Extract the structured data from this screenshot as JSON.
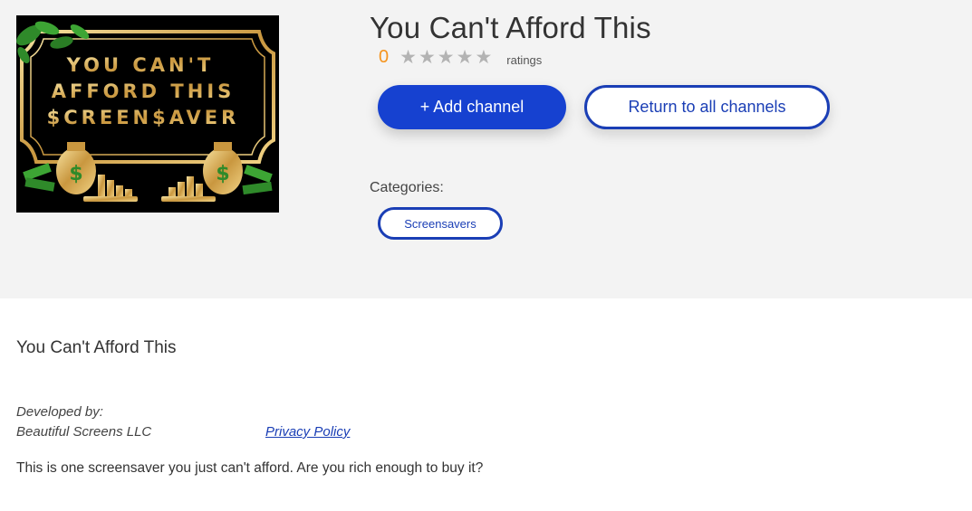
{
  "channel": {
    "title": "You Can't Afford This",
    "rating_count": "0",
    "stars": 5,
    "ratings_label": "ratings"
  },
  "poster": {
    "line1": "YOU CAN'T",
    "line2": "AFFORD THIS",
    "line3": "$CREEN$AVER",
    "icon": "money-bag-icon"
  },
  "buttons": {
    "add_label": "+ Add channel",
    "return_label": "Return to all channels"
  },
  "categories": {
    "label": "Categories:",
    "items": [
      "Screensavers"
    ]
  },
  "details": {
    "title": "You Can't Afford This",
    "developed_by_label": "Developed by:",
    "developer": "Beautiful Screens LLC",
    "privacy_label": "Privacy Policy",
    "description": "This is one screensaver you just can't afford. Are you rich enough to buy it?"
  },
  "colors": {
    "accent": "#1a3eb5",
    "button_fill": "#1641d0",
    "rating_count": "#f5941e",
    "star": "#b3b3b3",
    "hero_bg": "#f3f3f3",
    "gold": "#d9b35a"
  }
}
